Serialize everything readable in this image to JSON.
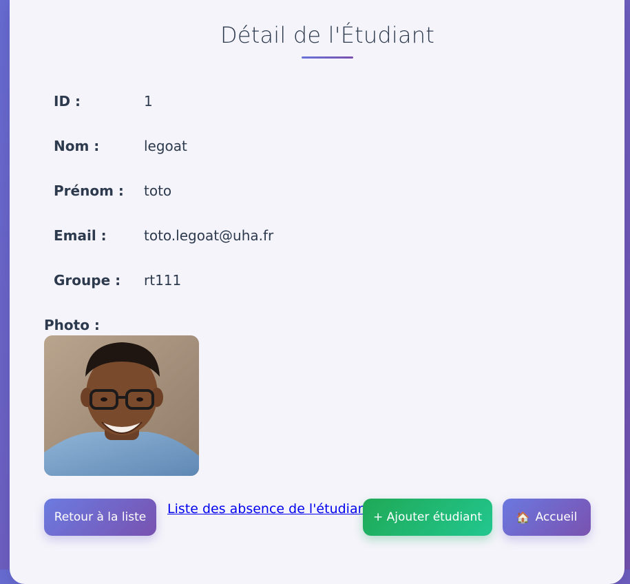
{
  "page": {
    "title": "Détail de l'Étudiant"
  },
  "fields": [
    {
      "label": "ID :",
      "value": "1"
    },
    {
      "label": "Nom :",
      "value": "legoat"
    },
    {
      "label": "Prénom :",
      "value": "toto"
    },
    {
      "label": "Email :",
      "value": "toto.legoat@uha.fr"
    },
    {
      "label": "Groupe :",
      "value": "rt111"
    }
  ],
  "photo": {
    "label": "Photo :"
  },
  "actions": {
    "back_label": "Retour à la liste",
    "absences_link": "Liste des absence de l'étudiant",
    "add_label": "+ Ajouter étudiant",
    "home_label": "Accueil",
    "home_icon": "house-icon"
  },
  "colors": {
    "accent": "#6c7be0",
    "accent_end": "#7852b0",
    "success": "#1fa956",
    "text": "#2d3a4e",
    "card_bg": "#f5f4fa"
  }
}
